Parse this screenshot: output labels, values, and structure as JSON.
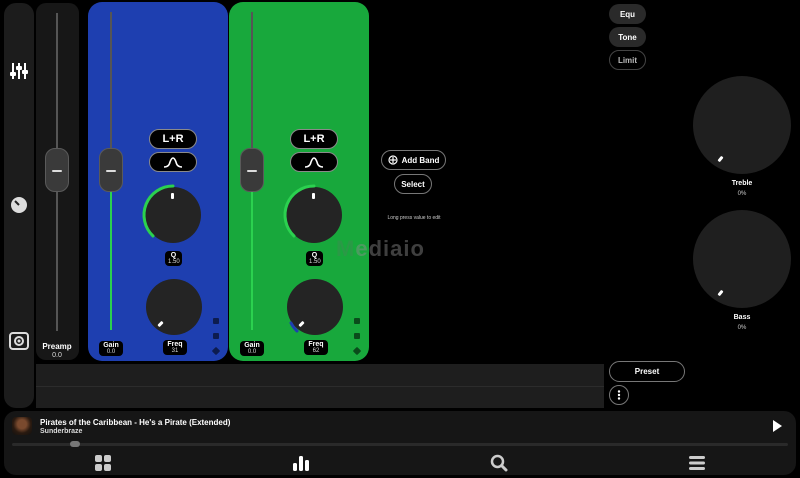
{
  "sidebar": {
    "icons": [
      "equalizer-sliders-icon",
      "knob-icon",
      "surround-icon"
    ]
  },
  "preamp": {
    "label": "Preamp",
    "value": "0.0",
    "level": 0.5
  },
  "bands": [
    {
      "color": "#1e3fb0",
      "channel": "L+R",
      "filter_icon": "bell-filter-icon",
      "q_label": "Q",
      "q_value": "1.50",
      "gain_label": "Gain",
      "gain_value": "0.0",
      "freq_label": "Freq",
      "freq_value": "31"
    },
    {
      "color": "#18a83c",
      "channel": "L+R",
      "filter_icon": "bell-filter-icon",
      "q_label": "Q",
      "q_value": "1.50",
      "gain_label": "Gain",
      "gain_value": "0.0",
      "freq_label": "Freq",
      "freq_value": "62"
    }
  ],
  "actions": {
    "add_band": "Add Band",
    "select": "Select",
    "hint": "Long press value to edit"
  },
  "modes": {
    "equ": "Equ",
    "tone": "Tone",
    "limit": "Limit"
  },
  "tone": {
    "treble_label": "Treble",
    "treble_value": "0%",
    "bass_label": "Bass",
    "bass_value": "0%"
  },
  "preset_label": "Preset",
  "watermark": "ediaio",
  "player": {
    "title": "Pirates of the Caribbean - He's a Pirate (Extended)",
    "artist": "Sunderbraze",
    "progress": 0.08
  },
  "nav": [
    "grid-icon",
    "equalizer-bars-icon",
    "search-icon",
    "menu-icon"
  ],
  "colors": {
    "blue_band": "#1e3fb0",
    "green_band": "#18a83c",
    "accent_green": "#2bd14f"
  }
}
